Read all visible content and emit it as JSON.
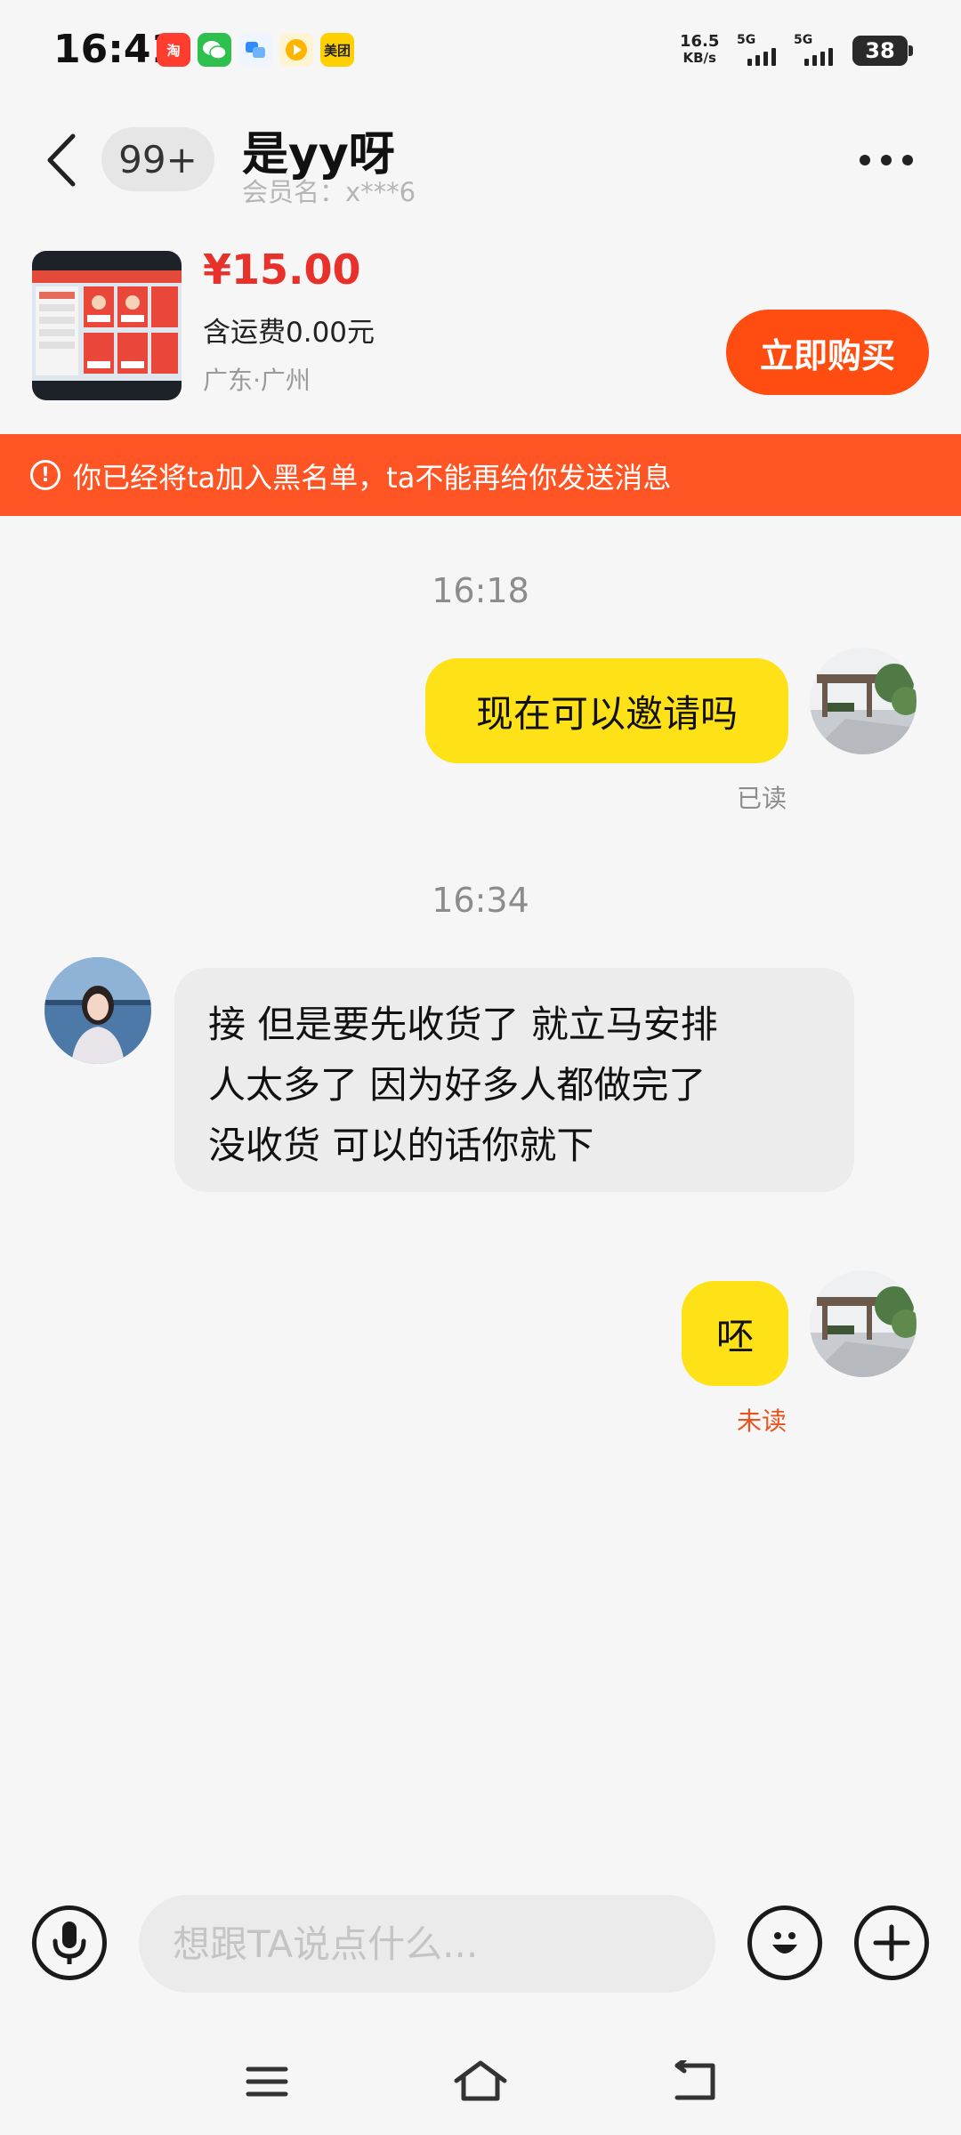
{
  "status_bar": {
    "time": "16:41",
    "apps": [
      {
        "name": "taobao-app-icon",
        "glyph": "淘",
        "color": "#ff3d2e"
      },
      {
        "name": "wechat-app-icon",
        "glyph": "",
        "color": "#2ec04f"
      },
      {
        "name": "message-app-icon",
        "glyph": "",
        "color": "#2f8cff"
      },
      {
        "name": "video-app-icon",
        "glyph": "",
        "color": "#ffb400"
      },
      {
        "name": "meituan-app-icon",
        "glyph": "美团",
        "color": "#ffd000"
      }
    ],
    "net_speed_value": "16.5",
    "net_speed_unit": "KB/s",
    "sim1_label": "5G",
    "sim2_label": "5G",
    "battery": "38"
  },
  "header": {
    "unread_badge": "99+",
    "title": "是yy呀",
    "subtitle": "会员名：x***6"
  },
  "product": {
    "price": "¥15.00",
    "shipping": "含运费0.00元",
    "location": "广东·广州",
    "buy_label": "立即购买"
  },
  "banner": {
    "icon": "!",
    "text": "你已经将ta加入黑名单，ta不能再给你发送消息"
  },
  "messages": {
    "timestamp_1": "16:18",
    "msg_1": "现在可以邀请吗",
    "msg_1_status": "已读",
    "timestamp_2": "16:34",
    "msg_2_lines": [
      "接 但是要先收货了 就立马安排",
      "人太多了 因为好多人都做完了",
      "没收货 可以的话你就下"
    ],
    "msg_3": "呸",
    "msg_3_status": "未读"
  },
  "input": {
    "placeholder": "想跟TA说点什么..."
  },
  "colors": {
    "accent": "#ff4d11",
    "banner": "#ff5423",
    "price": "#e8312a",
    "my_bubble": "#ffe118",
    "other_bubble": "#ececec"
  }
}
